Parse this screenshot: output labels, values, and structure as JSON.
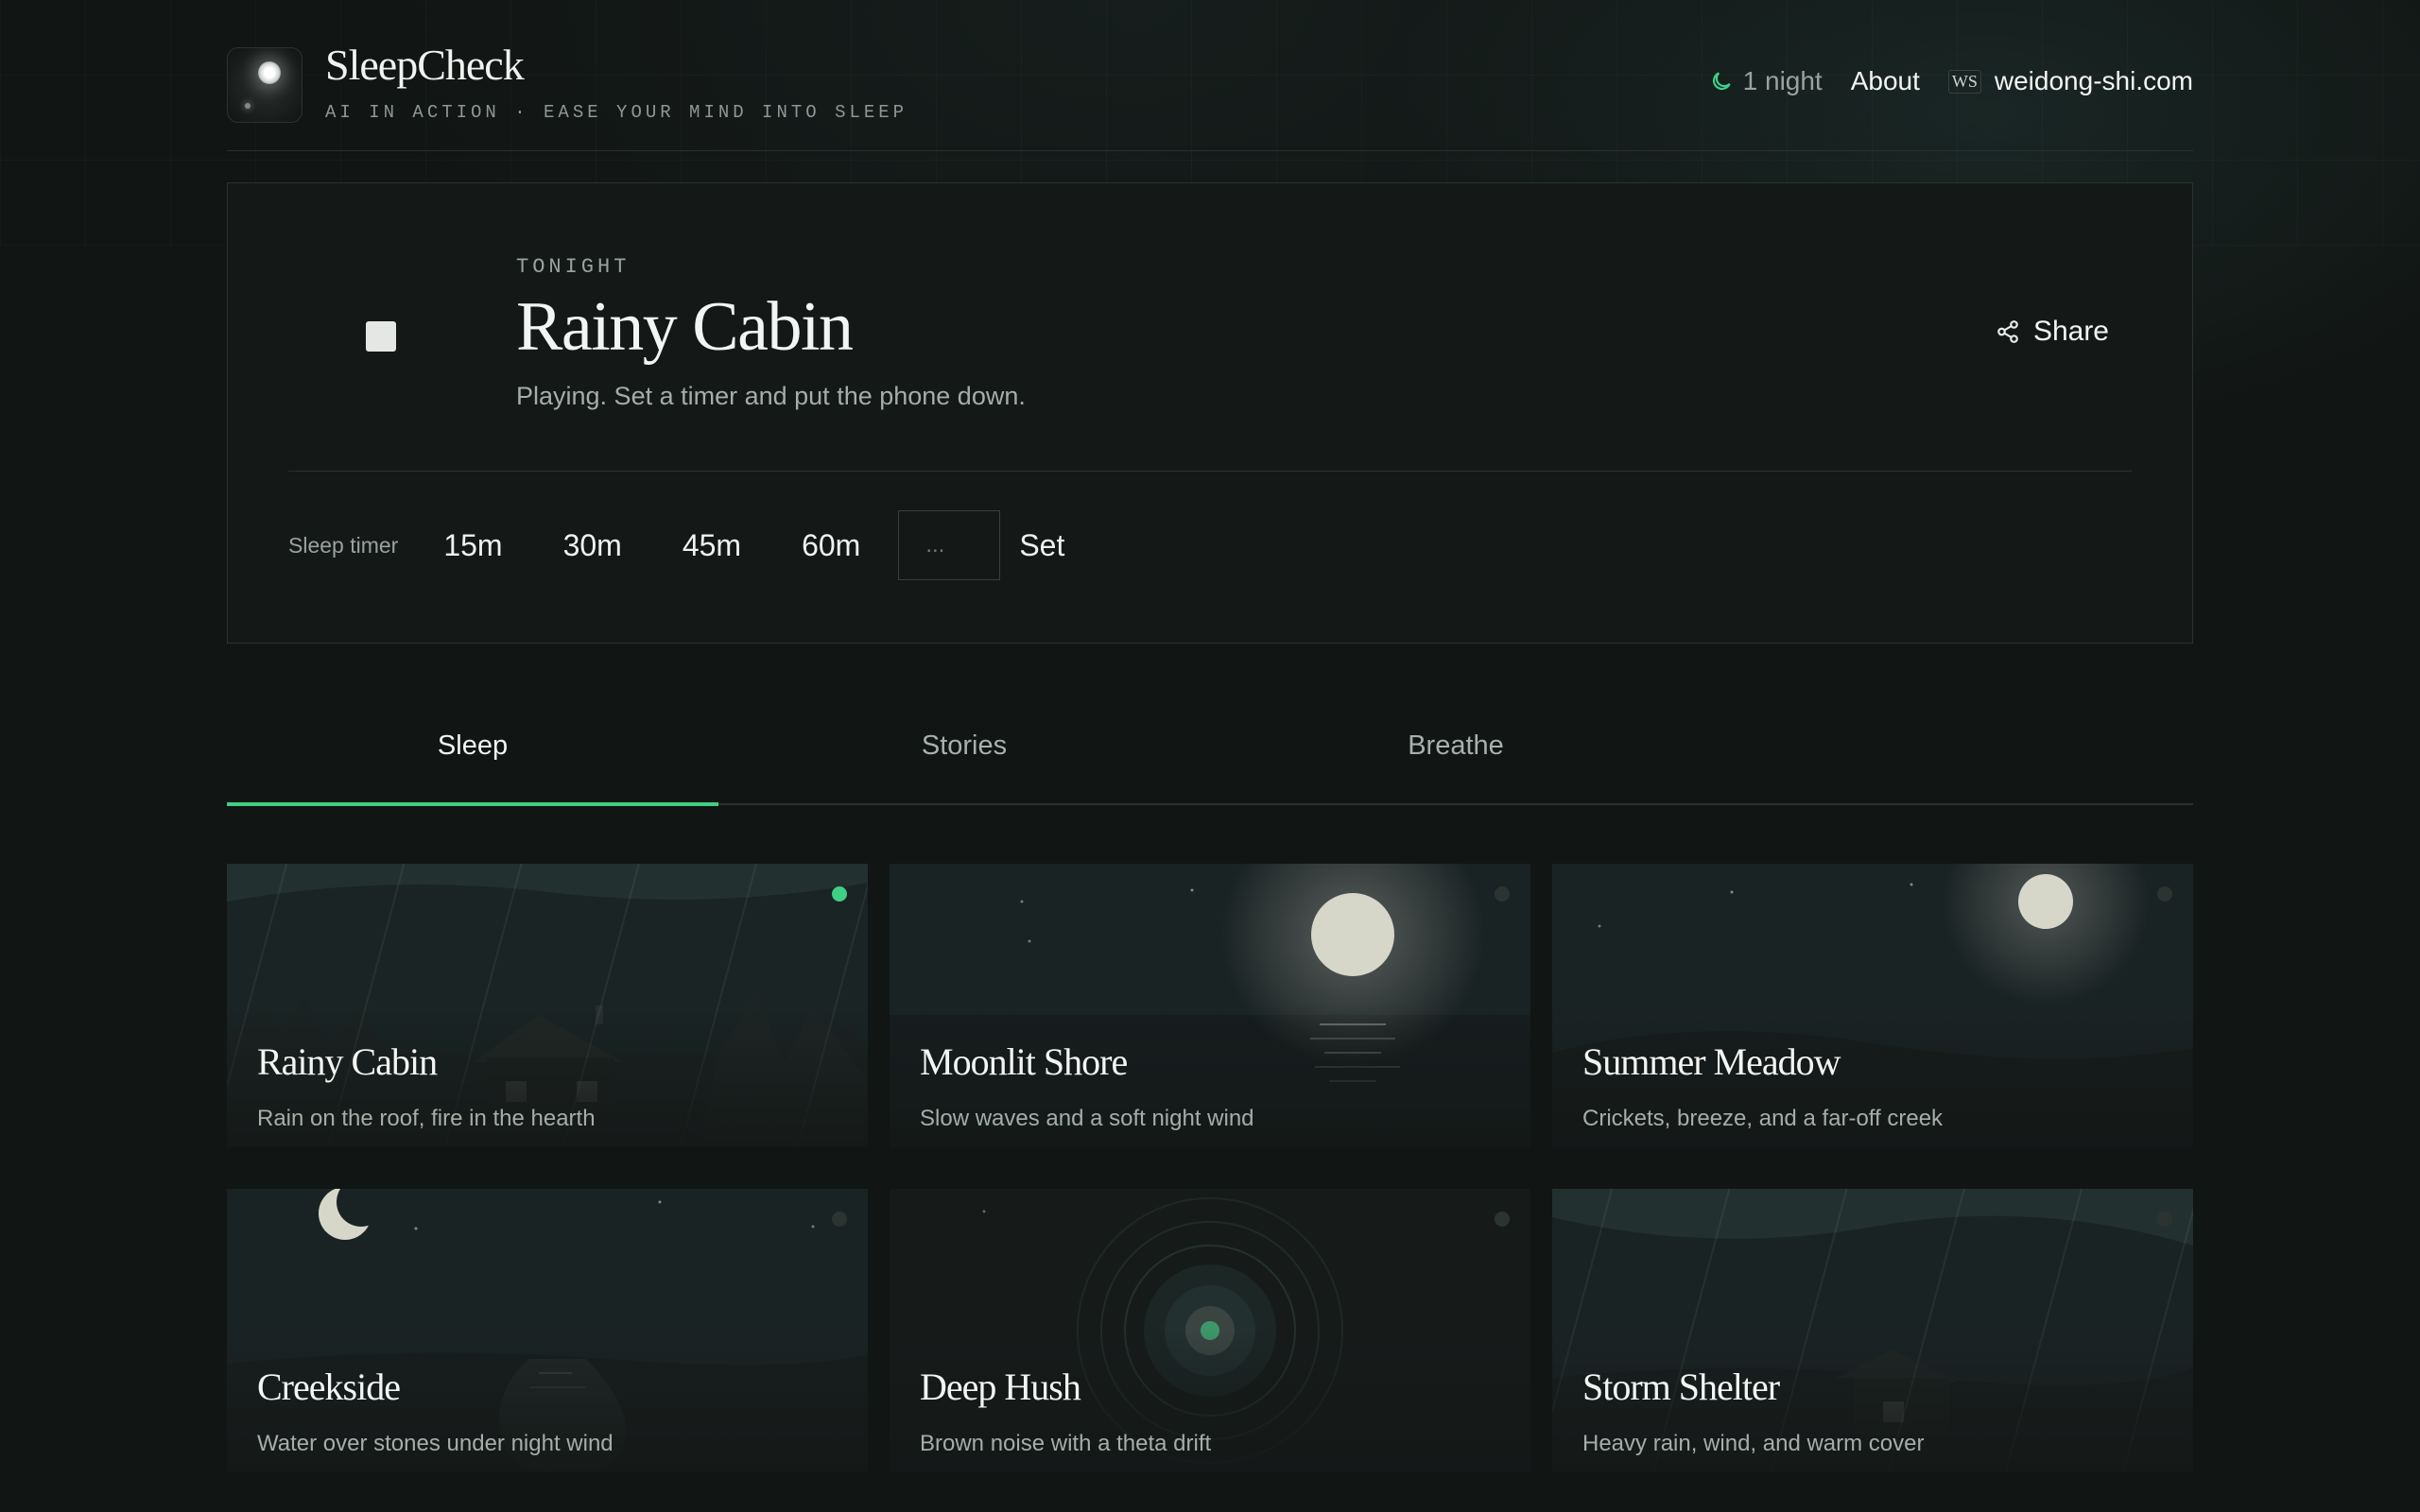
{
  "header": {
    "app_title": "SleepCheck",
    "tagline": "AI IN ACTION · EASE YOUR MIND INTO SLEEP",
    "nights": "1 night",
    "about": "About",
    "site_badge": "WS",
    "site": "weidong-shi.com"
  },
  "hero": {
    "eyebrow": "TONIGHT",
    "title": "Rainy Cabin",
    "description": "Playing. Set a timer and put the phone down.",
    "share": "Share"
  },
  "timer": {
    "label": "Sleep timer",
    "options": [
      "15m",
      "30m",
      "45m",
      "60m"
    ],
    "custom_placeholder": "...",
    "set": "Set"
  },
  "tabs": [
    {
      "label": "Sleep",
      "active": true
    },
    {
      "label": "Stories",
      "active": false
    },
    {
      "label": "Breathe",
      "active": false
    }
  ],
  "cards": [
    {
      "title": "Rainy Cabin",
      "subtitle": "Rain on the roof, fire in the hearth",
      "playing": true
    },
    {
      "title": "Moonlit Shore",
      "subtitle": "Slow waves and a soft night wind",
      "playing": false
    },
    {
      "title": "Summer Meadow",
      "subtitle": "Crickets, breeze, and a far-off creek",
      "playing": false
    },
    {
      "title": "Creekside",
      "subtitle": "Water over stones under night wind",
      "playing": false
    },
    {
      "title": "Deep Hush",
      "subtitle": "Brown noise with a theta drift",
      "playing": false
    },
    {
      "title": "Storm Shelter",
      "subtitle": "Heavy rain, wind, and warm cover",
      "playing": false
    }
  ],
  "colors": {
    "accent": "#3fcf85",
    "background": "#111513"
  }
}
